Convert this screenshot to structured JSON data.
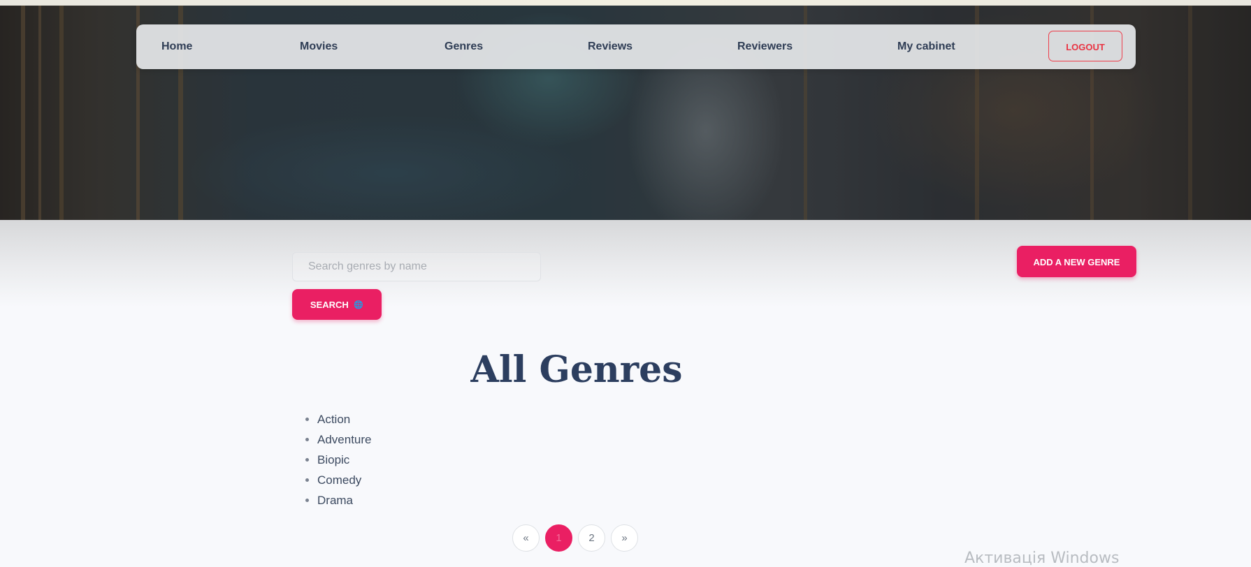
{
  "nav": {
    "home": "Home",
    "movies": "Movies",
    "genres": "Genres",
    "reviews": "Reviews",
    "reviewers": "Reviewers",
    "cabinet": "My cabinet",
    "logout": "LOGOUT"
  },
  "search": {
    "placeholder": "Search genres by name",
    "value": "",
    "button_label": "SEARCH",
    "button_icon": "globe-icon",
    "button_icon_glyph": "🌐"
  },
  "add_button": "ADD A NEW GENRE",
  "page_title": "All Genres",
  "genres": [
    "Action",
    "Adventure",
    "Biopic",
    "Comedy",
    "Drama"
  ],
  "pagination": {
    "prev": "«",
    "pages": [
      "1",
      "2"
    ],
    "current": "1",
    "next": "»"
  },
  "watermark": "Активація Windows",
  "colors": {
    "accent": "#ea1f63",
    "logout": "#ee3d4a",
    "title": "#2c3e5f",
    "nav_text": "#2f3d55"
  }
}
